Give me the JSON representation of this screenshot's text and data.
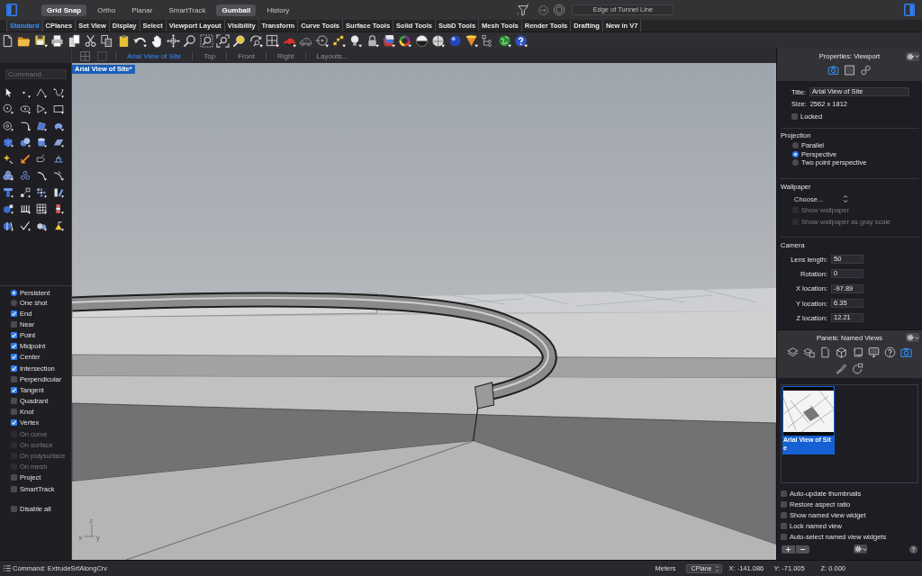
{
  "top_bar": {
    "toggles": [
      {
        "label": "Grid Snap",
        "selected": true
      },
      {
        "label": "Ortho",
        "selected": false
      },
      {
        "label": "Planar",
        "selected": false
      },
      {
        "label": "SmartTrack",
        "selected": false
      },
      {
        "label": "Gumball",
        "selected": true
      },
      {
        "label": "History",
        "selected": false
      }
    ],
    "filter_field": "Edge of Tunnel Line"
  },
  "toolbar_tabs": [
    {
      "label": "Standard",
      "selected": true
    },
    {
      "label": "CPlanes",
      "selected": false
    },
    {
      "label": "Set View",
      "selected": false
    },
    {
      "label": "Display",
      "selected": false
    },
    {
      "label": "Select",
      "selected": false
    },
    {
      "label": "Viewport Layout",
      "selected": false
    },
    {
      "label": "Visibility",
      "selected": false
    },
    {
      "label": "Transform",
      "selected": false
    },
    {
      "label": "Curve Tools",
      "selected": false
    },
    {
      "label": "Surface Tools",
      "selected": false
    },
    {
      "label": "Solid Tools",
      "selected": false
    },
    {
      "label": "SubD Tools",
      "selected": false
    },
    {
      "label": "Mesh Tools",
      "selected": false
    },
    {
      "label": "Render Tools",
      "selected": false
    },
    {
      "label": "Drafting",
      "selected": false
    },
    {
      "label": "New in V7",
      "selected": false
    }
  ],
  "sidebar": {
    "command_field": {
      "placeholder": "Command"
    },
    "osnap_modes": [
      {
        "label": "Persistent",
        "selected": true
      },
      {
        "label": "One shot",
        "selected": false
      }
    ],
    "osnaps": [
      {
        "label": "End",
        "checked": true,
        "disabled": false
      },
      {
        "label": "Near",
        "checked": false,
        "disabled": false
      },
      {
        "label": "Point",
        "checked": true,
        "disabled": false
      },
      {
        "label": "Midpoint",
        "checked": true,
        "disabled": false
      },
      {
        "label": "Center",
        "checked": true,
        "disabled": false
      },
      {
        "label": "Intersection",
        "checked": true,
        "disabled": false
      },
      {
        "label": "Perpendicular",
        "checked": false,
        "disabled": false
      },
      {
        "label": "Tangent",
        "checked": true,
        "disabled": false
      },
      {
        "label": "Quadrant",
        "checked": false,
        "disabled": false
      },
      {
        "label": "Knot",
        "checked": false,
        "disabled": false
      },
      {
        "label": "Vertex",
        "checked": true,
        "disabled": false
      },
      {
        "label": "On curve",
        "checked": false,
        "disabled": true
      },
      {
        "label": "On surface",
        "checked": false,
        "disabled": true
      },
      {
        "label": "On polysurface",
        "checked": false,
        "disabled": true
      },
      {
        "label": "On mesh",
        "checked": false,
        "disabled": true
      },
      {
        "label": "Project",
        "checked": false,
        "disabled": false
      },
      {
        "label": "SmartTrack",
        "checked": false,
        "disabled": false
      }
    ],
    "disable_all": {
      "label": "Disable all",
      "checked": false
    }
  },
  "view_tabs": [
    {
      "label": "Arial View of Site",
      "selected": true
    },
    {
      "label": "Top",
      "selected": false
    },
    {
      "label": "Front",
      "selected": false
    },
    {
      "label": "Right",
      "selected": false
    },
    {
      "label": "Layouts...",
      "selected": false
    }
  ],
  "viewport": {
    "title": "Arial View of Site*",
    "axes": {
      "z": "z",
      "x": "x",
      "y": "y"
    }
  },
  "properties": {
    "header": "Properties: Viewport",
    "tabs": [
      {
        "selected": true
      },
      {
        "selected": false
      },
      {
        "selected": false
      }
    ],
    "title": {
      "label": "Title:",
      "value": "Arial View of Site"
    },
    "size": {
      "label": "Size:",
      "value": "2562 x 1812"
    },
    "locked": {
      "label": "Locked",
      "checked": false
    },
    "projection": {
      "heading": "Projection",
      "options": [
        {
          "label": "Parallel",
          "selected": false
        },
        {
          "label": "Perspective",
          "selected": true
        },
        {
          "label": "Two point perspective",
          "selected": false
        }
      ]
    },
    "wallpaper": {
      "heading": "Wallpaper",
      "dropdown": "Choose...",
      "options": [
        {
          "label": "Show wallpaper",
          "checked": false,
          "disabled": true
        },
        {
          "label": "Show wallpaper as gray scale",
          "checked": false,
          "disabled": true
        }
      ]
    },
    "camera": {
      "heading": "Camera",
      "fields": [
        {
          "label": "Lens length:",
          "value": "50"
        },
        {
          "label": "Rotation:",
          "value": "0"
        },
        {
          "label": "X location:",
          "value": "-97.89"
        },
        {
          "label": "Y location:",
          "value": "6.35"
        },
        {
          "label": "Z location:",
          "value": "12.21"
        }
      ]
    }
  },
  "named_views": {
    "header": "Panels: Named Views",
    "tabs": [
      {
        "selected": false
      },
      {
        "selected": false
      },
      {
        "selected": false
      },
      {
        "selected": false
      },
      {
        "selected": false
      },
      {
        "selected": false
      },
      {
        "selected": false
      },
      {
        "selected": true
      },
      {
        "selected": false
      },
      {
        "selected": false
      }
    ],
    "views": [
      {
        "label": "Arial View of Site",
        "selected": true
      }
    ],
    "options": [
      {
        "label": "Auto-update thumbnails",
        "checked": false
      },
      {
        "label": "Restore aspect ratio",
        "checked": false
      },
      {
        "label": "Show named view widget",
        "checked": false
      },
      {
        "label": "Lock named view",
        "checked": false
      },
      {
        "label": "Auto-select named view widgets",
        "checked": false
      }
    ]
  },
  "status_bar": {
    "command": "Command: ExtrudeSrfAlongCrv",
    "units": "Meters",
    "plane": "CPlane",
    "x": "X: -141.086",
    "y": "Y: -71.005",
    "z": "Z: 0.000"
  }
}
